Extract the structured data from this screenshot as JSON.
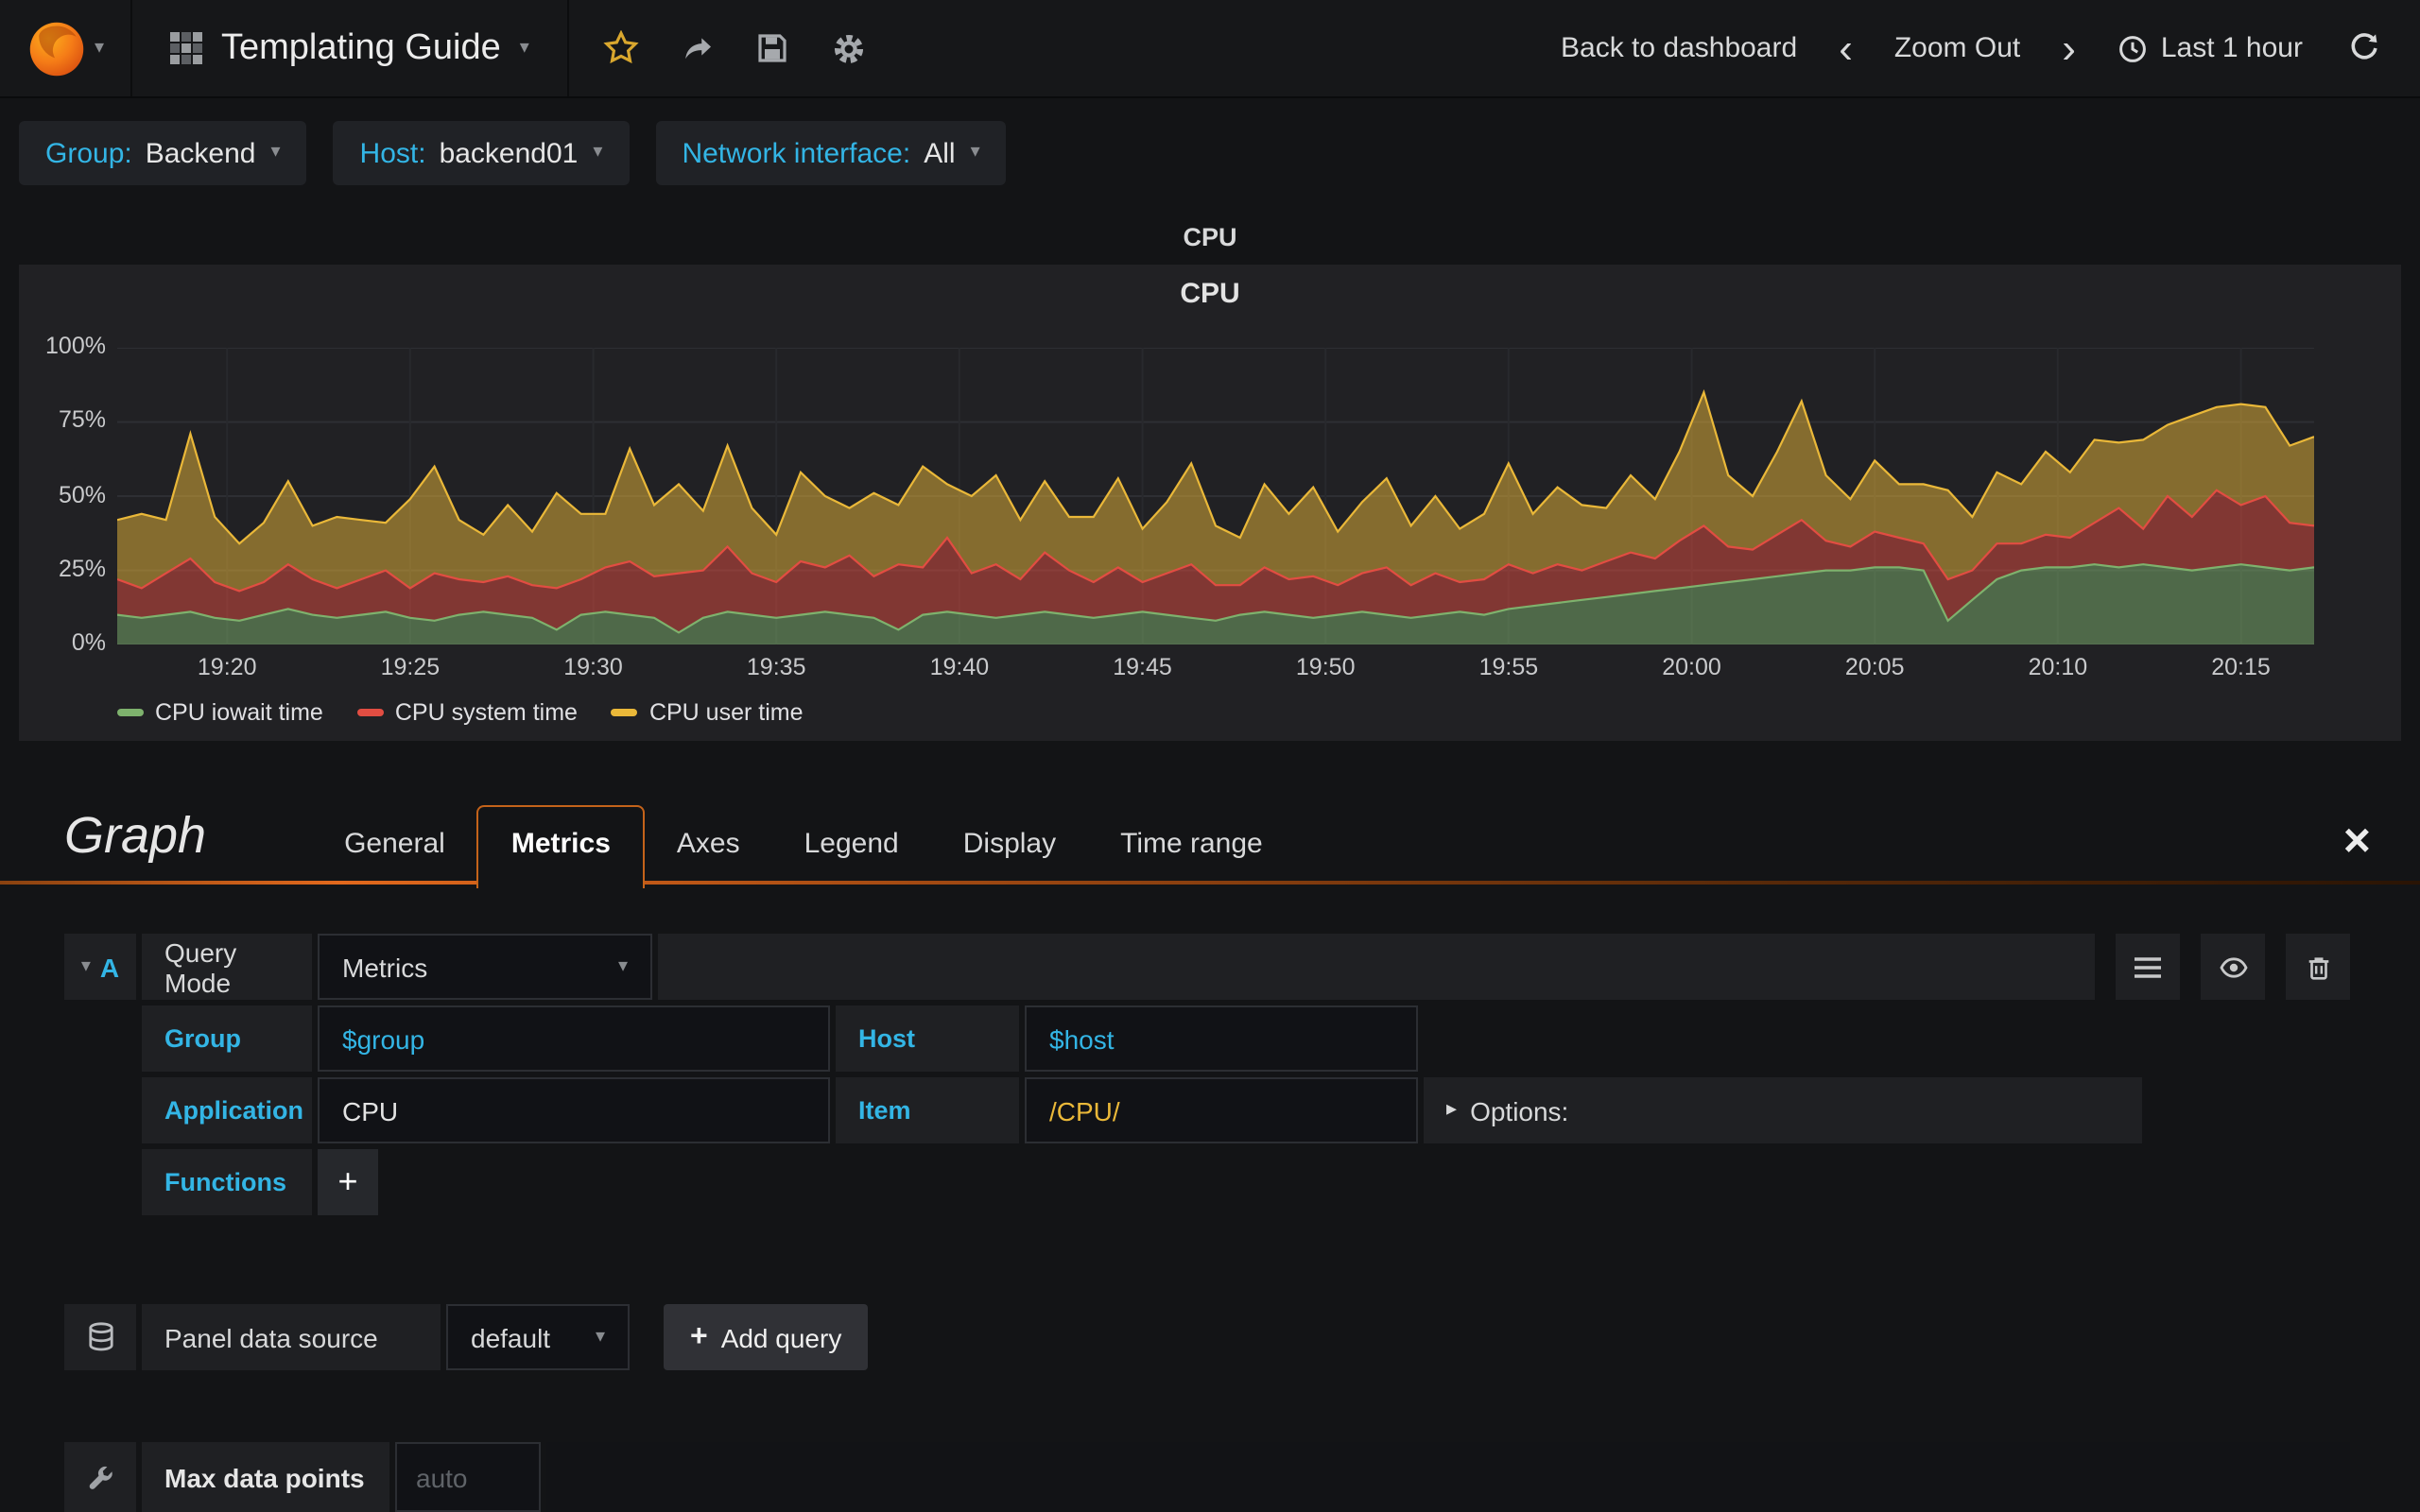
{
  "glyphs": {
    "caret_down": "▾",
    "caret_right": "▸",
    "plus": "+",
    "close": "×",
    "chevron_left": "‹",
    "chevron_right": "›"
  },
  "navbar": {
    "dashboard_title": "Templating Guide",
    "back_to_dashboard": "Back to dashboard",
    "zoom_out": "Zoom Out",
    "time_range": "Last 1 hour",
    "icons": [
      "grafana-logo",
      "grid-icon",
      "star-icon",
      "share-icon",
      "save-icon",
      "gear-icon",
      "chevron-left-icon",
      "chevron-right-icon",
      "clock-icon",
      "refresh-icon"
    ]
  },
  "variables": [
    {
      "label": "Group:",
      "value": "Backend"
    },
    {
      "label": "Host:",
      "value": "backend01"
    },
    {
      "label": "Network interface:",
      "value": "All"
    }
  ],
  "panel": {
    "title": "CPU"
  },
  "chart_data": {
    "type": "area",
    "stacked": true,
    "title": "CPU",
    "ylim": [
      0,
      100
    ],
    "x_span_minutes": 60,
    "x_ticks": [
      {
        "label": "19:20",
        "min": 3
      },
      {
        "label": "19:25",
        "min": 8
      },
      {
        "label": "19:30",
        "min": 13
      },
      {
        "label": "19:35",
        "min": 18
      },
      {
        "label": "19:40",
        "min": 23
      },
      {
        "label": "19:45",
        "min": 28
      },
      {
        "label": "19:50",
        "min": 33
      },
      {
        "label": "19:55",
        "min": 38
      },
      {
        "label": "20:00",
        "min": 43
      },
      {
        "label": "20:05",
        "min": 48
      },
      {
        "label": "20:10",
        "min": 53
      },
      {
        "label": "20:15",
        "min": 58
      }
    ],
    "y_ticks": [
      {
        "label": "0%",
        "value": 0
      },
      {
        "label": "25%",
        "value": 25
      },
      {
        "label": "50%",
        "value": 50
      },
      {
        "label": "75%",
        "value": 75
      },
      {
        "label": "100%",
        "value": 100
      }
    ],
    "series": [
      {
        "name": "CPU iowait time",
        "color": "#7EB26D",
        "values": [
          10,
          9,
          10,
          11,
          9,
          8,
          10,
          12,
          10,
          9,
          10,
          11,
          9,
          8,
          10,
          11,
          10,
          9,
          5,
          10,
          11,
          10,
          9,
          4,
          9,
          11,
          10,
          9,
          10,
          11,
          10,
          9,
          5,
          10,
          11,
          10,
          9,
          10,
          11,
          10,
          9,
          10,
          11,
          10,
          9,
          8,
          10,
          11,
          10,
          9,
          10,
          11,
          10,
          9,
          10,
          11,
          10,
          12,
          13,
          14,
          15,
          16,
          17,
          18,
          19,
          20,
          21,
          22,
          23,
          24,
          25,
          25,
          26,
          26,
          25,
          8,
          15,
          22,
          25,
          26,
          26,
          27,
          26,
          27,
          26,
          25,
          26,
          27,
          26,
          25,
          26
        ]
      },
      {
        "name": "CPU system time",
        "color": "#E24D42",
        "values": [
          12,
          10,
          14,
          18,
          12,
          10,
          11,
          15,
          12,
          10,
          12,
          14,
          10,
          16,
          12,
          10,
          13,
          11,
          14,
          12,
          15,
          18,
          14,
          20,
          16,
          22,
          14,
          12,
          18,
          15,
          20,
          14,
          22,
          16,
          25,
          14,
          18,
          12,
          20,
          15,
          12,
          16,
          10,
          14,
          18,
          12,
          10,
          15,
          12,
          14,
          10,
          13,
          16,
          11,
          14,
          10,
          12,
          15,
          11,
          13,
          10,
          12,
          14,
          11,
          16,
          20,
          12,
          10,
          14,
          18,
          10,
          8,
          12,
          10,
          9,
          14,
          10,
          12,
          9,
          11,
          10,
          14,
          20,
          12,
          24,
          18,
          26,
          20,
          24,
          16,
          14
        ]
      },
      {
        "name": "CPU user time",
        "color": "#EAB839",
        "values": [
          20,
          25,
          18,
          42,
          22,
          16,
          20,
          28,
          18,
          24,
          20,
          16,
          30,
          36,
          20,
          16,
          24,
          18,
          32,
          22,
          18,
          38,
          24,
          30,
          20,
          34,
          22,
          16,
          30,
          24,
          16,
          28,
          20,
          34,
          18,
          26,
          30,
          20,
          24,
          18,
          22,
          30,
          18,
          24,
          34,
          20,
          16,
          28,
          22,
          30,
          18,
          24,
          30,
          20,
          26,
          18,
          22,
          34,
          20,
          26,
          22,
          18,
          26,
          20,
          30,
          45,
          24,
          18,
          28,
          40,
          22,
          16,
          24,
          18,
          20,
          30,
          18,
          24,
          20,
          28,
          22,
          28,
          22,
          30,
          24,
          34,
          28,
          34,
          30,
          26,
          30
        ]
      }
    ],
    "legend_position": "bottom-left",
    "grid": true
  },
  "editor": {
    "title": "Graph",
    "tabs": [
      "General",
      "Metrics",
      "Axes",
      "Legend",
      "Display",
      "Time range"
    ],
    "active_tab": "Metrics",
    "query": {
      "ref": "A",
      "mode_label": "Query Mode",
      "mode_value": "Metrics",
      "options_label": "Options:",
      "rows": [
        {
          "label": "Group",
          "value": "$group",
          "label2": "Host",
          "value2": "$host"
        },
        {
          "label": "Application",
          "value": "CPU",
          "label2": "Item",
          "value2": "/CPU/"
        },
        {
          "label": "Functions"
        }
      ]
    },
    "datasource": {
      "label": "Panel data source",
      "value": "default",
      "add_query": "Add query"
    },
    "max_data_points": {
      "label": "Max data points",
      "placeholder": "auto"
    }
  },
  "colors": {
    "accent_orange": "#E2691D",
    "cyan": "#33B5E5",
    "yellow": "#EAB839"
  }
}
